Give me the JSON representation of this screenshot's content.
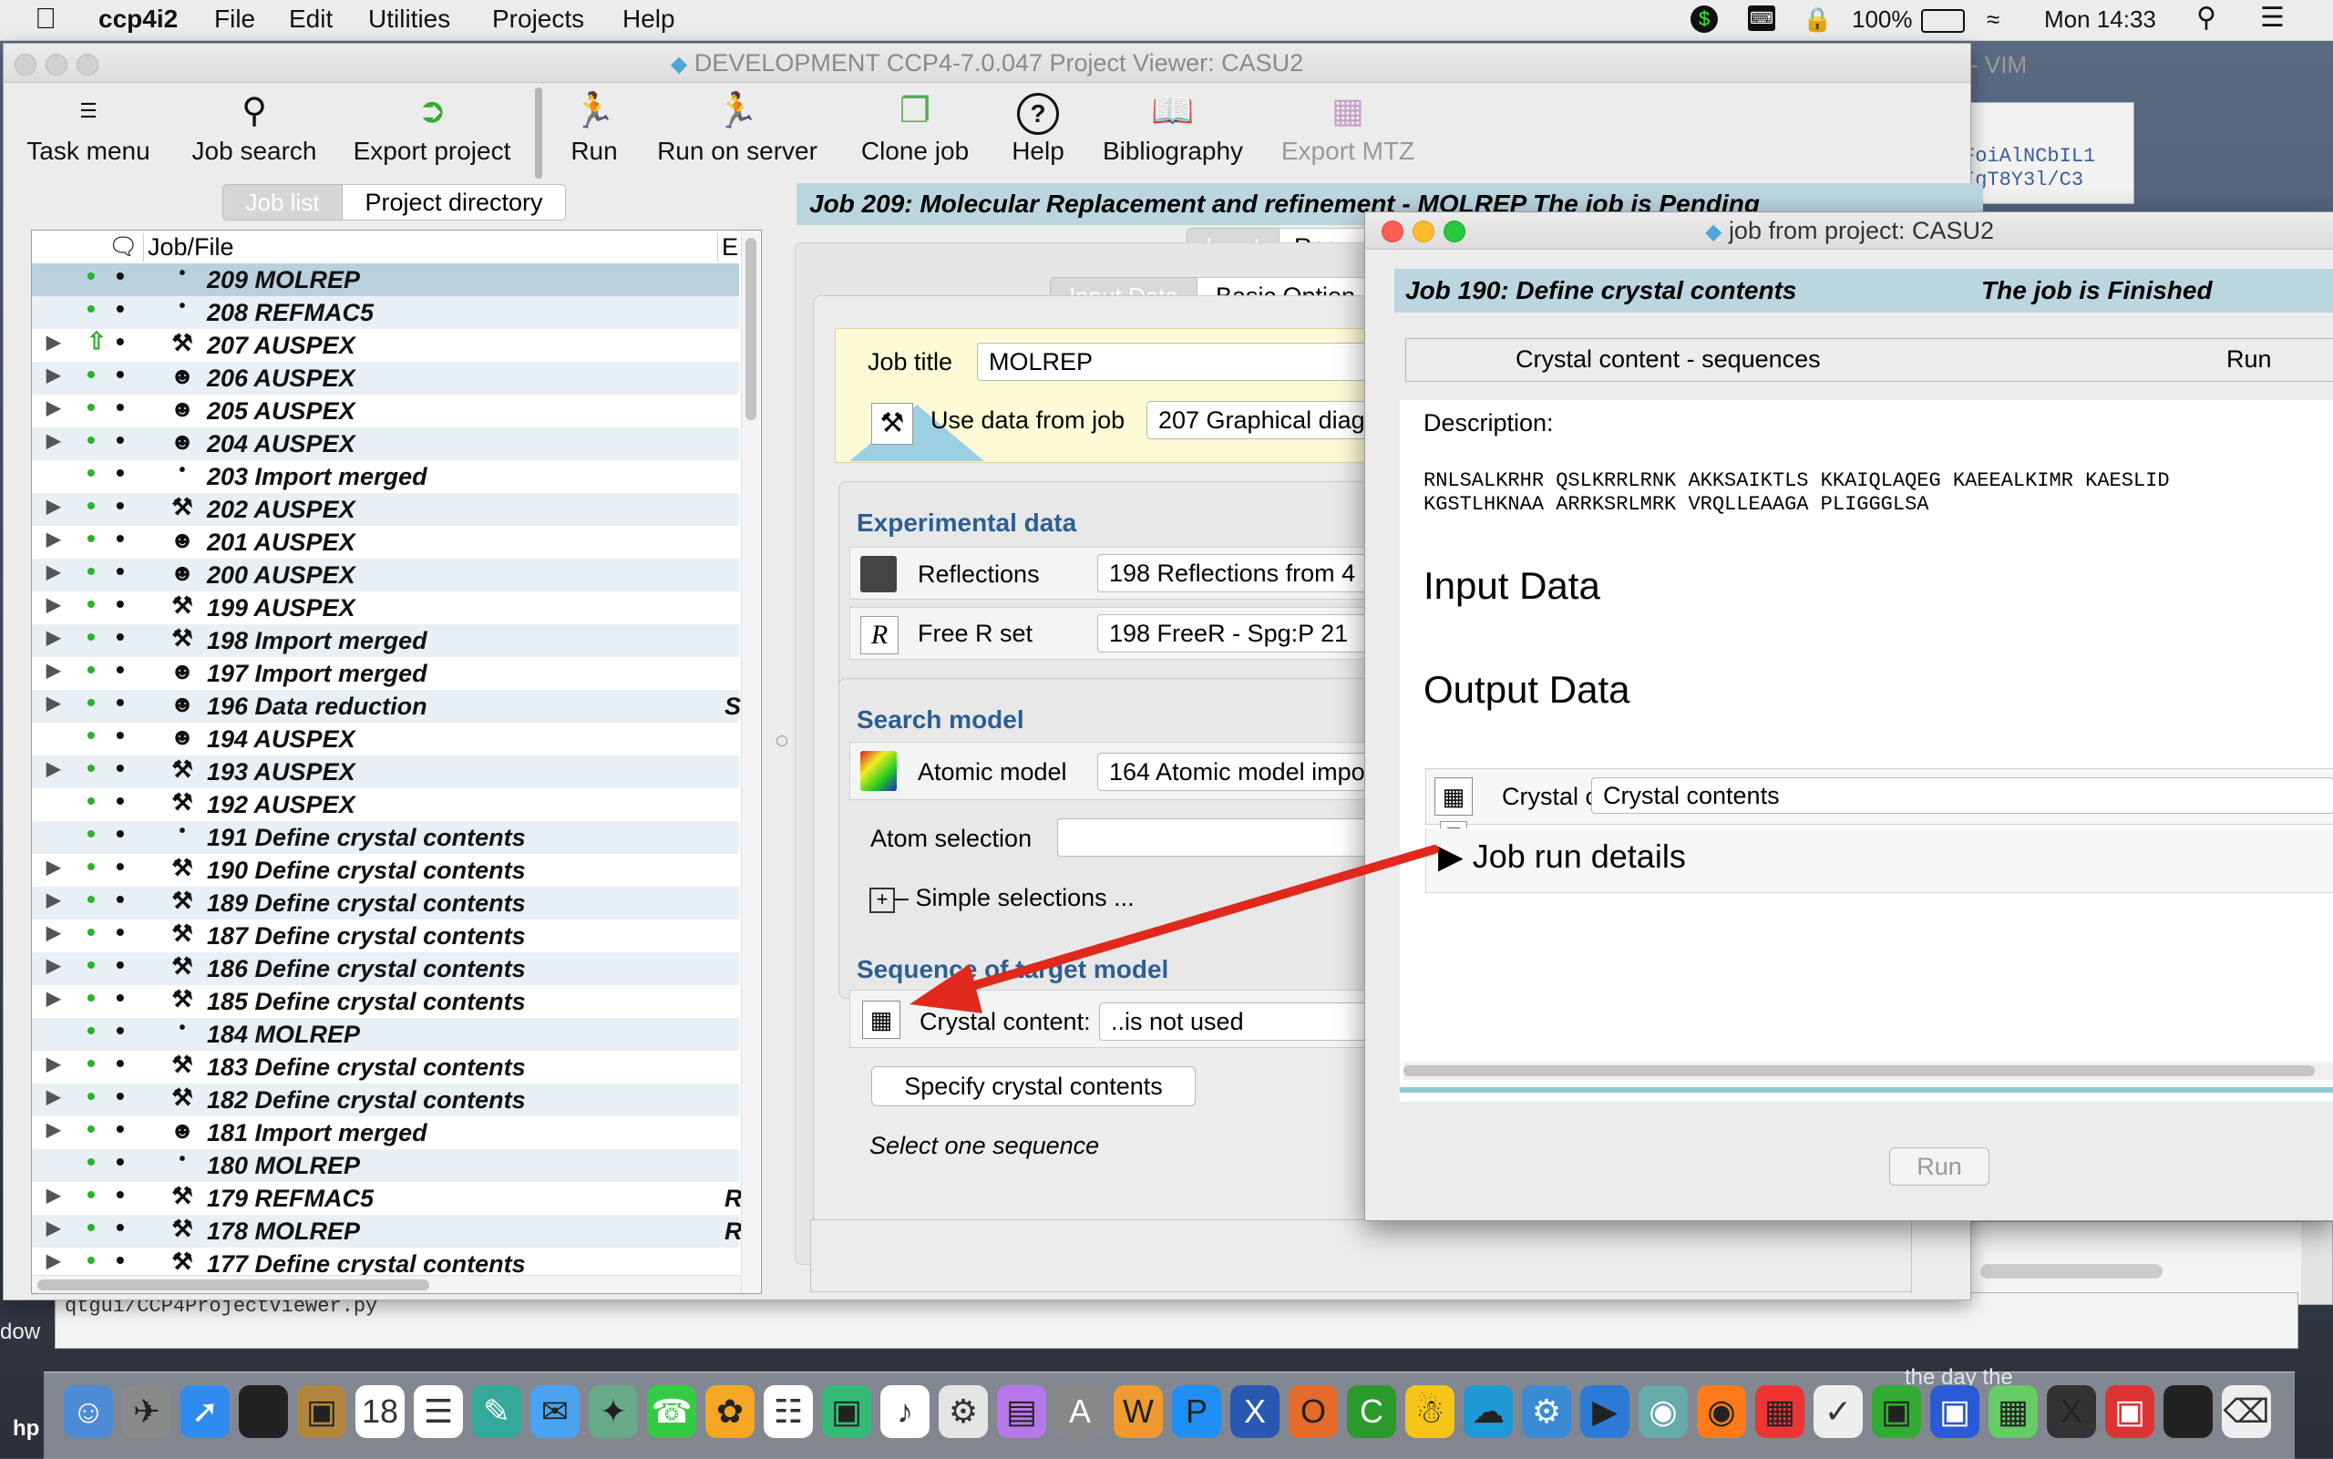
{
  "menubar": {
    "app_name": "ccp4i2",
    "items": [
      "File",
      "Edit",
      "Utilities",
      "Projects",
      "Help"
    ],
    "battery": "100%",
    "clock": "Mon 14:33"
  },
  "bg_window": {
    "title_fragment": "- VIM",
    "code_line1": "FoiAlNCbIL1",
    "code_line2": "IgT8Y3l/C3",
    "path": "qtgui/CCP4ProjectViewer.py",
    "desktop_text": "the day the",
    "desktop_left1": "dow",
    "desktop_left2": "hp"
  },
  "main_window": {
    "title": "DEVELOPMENT CCP4-7.0.047 Project Viewer: CASU2",
    "toolbar": [
      {
        "label": "Task menu",
        "icon": "task-menu-icon"
      },
      {
        "label": "Job search",
        "icon": "magnifier-icon"
      },
      {
        "label": "Export project",
        "icon": "export-icon"
      },
      {
        "label": "Run",
        "icon": "runner-icon"
      },
      {
        "label": "Run on server",
        "icon": "runner-server-icon"
      },
      {
        "label": "Clone job",
        "icon": "clone-icon"
      },
      {
        "label": "Help",
        "icon": "help-icon"
      },
      {
        "label": "Bibliography",
        "icon": "bibliography-icon"
      },
      {
        "label": "Export MTZ",
        "icon": "export-mtz-icon"
      }
    ],
    "tabs": {
      "job_list": "Job list",
      "project_directory": "Project directory"
    },
    "job_list_headers": {
      "file": "Job/File",
      "e": "E"
    },
    "jobs": [
      {
        "label": "209 MOLREP",
        "icon": "bullet",
        "tri": "",
        "e": ""
      },
      {
        "label": "208 REFMAC5",
        "icon": "bullet",
        "tri": "",
        "e": ""
      },
      {
        "label": "207 AUSPEX",
        "icon": "hammer",
        "tri": "▶",
        "e": ""
      },
      {
        "label": "206 AUSPEX",
        "icon": "face",
        "tri": "▶",
        "e": ""
      },
      {
        "label": "205 AUSPEX",
        "icon": "face",
        "tri": "▶",
        "e": ""
      },
      {
        "label": "204 AUSPEX",
        "icon": "face",
        "tri": "▶",
        "e": ""
      },
      {
        "label": "203 Import merged",
        "icon": "bullet",
        "tri": "",
        "e": ""
      },
      {
        "label": "202 AUSPEX",
        "icon": "hammer",
        "tri": "▶",
        "e": ""
      },
      {
        "label": "201 AUSPEX",
        "icon": "face",
        "tri": "▶",
        "e": ""
      },
      {
        "label": "200 AUSPEX",
        "icon": "face",
        "tri": "▶",
        "e": ""
      },
      {
        "label": "199 AUSPEX",
        "icon": "hammer",
        "tri": "▶",
        "e": ""
      },
      {
        "label": "198 Import merged",
        "icon": "hammer",
        "tri": "▶",
        "e": ""
      },
      {
        "label": "197 Import merged",
        "icon": "face",
        "tri": "▶",
        "e": ""
      },
      {
        "label": "196 Data reduction",
        "icon": "face",
        "tri": "▶",
        "e": "S"
      },
      {
        "label": "194 AUSPEX",
        "icon": "face",
        "tri": "",
        "e": ""
      },
      {
        "label": "193 AUSPEX",
        "icon": "hammer",
        "tri": "▶",
        "e": ""
      },
      {
        "label": "192 AUSPEX",
        "icon": "hammer",
        "tri": "",
        "e": ""
      },
      {
        "label": "191 Define crystal contents",
        "icon": "bullet",
        "tri": "",
        "e": ""
      },
      {
        "label": "190 Define crystal contents",
        "icon": "hammer",
        "tri": "▶",
        "e": ""
      },
      {
        "label": "189 Define crystal contents",
        "icon": "hammer",
        "tri": "▶",
        "e": ""
      },
      {
        "label": "187 Define crystal contents",
        "icon": "hammer",
        "tri": "▶",
        "e": ""
      },
      {
        "label": "186 Define crystal contents",
        "icon": "hammer",
        "tri": "▶",
        "e": ""
      },
      {
        "label": "185 Define crystal contents",
        "icon": "hammer",
        "tri": "▶",
        "e": ""
      },
      {
        "label": "184 MOLREP",
        "icon": "bullet",
        "tri": "",
        "e": ""
      },
      {
        "label": "183 Define crystal contents",
        "icon": "hammer",
        "tri": "▶",
        "e": ""
      },
      {
        "label": "182 Define crystal contents",
        "icon": "hammer",
        "tri": "▶",
        "e": ""
      },
      {
        "label": "181 Import merged",
        "icon": "face",
        "tri": "▶",
        "e": ""
      },
      {
        "label": "180 MOLREP",
        "icon": "bullet",
        "tri": "",
        "e": ""
      },
      {
        "label": "179 REFMAC5",
        "icon": "hammer",
        "tri": "▶",
        "e": "R"
      },
      {
        "label": "178 MOLREP",
        "icon": "hammer",
        "tri": "▶",
        "e": "R"
      },
      {
        "label": "177 Define crystal contents",
        "icon": "hammer",
        "tri": "▶",
        "e": ""
      }
    ],
    "job_header": "Job 209:  Molecular Replacement and refinement - MOLREP   The job is Pending",
    "mode_tabs": {
      "input": "Input",
      "results": "Resu"
    },
    "sub_tabs": {
      "input_data": "Input Data",
      "basic_options": "Basic Option"
    },
    "job_title_label": "Job title",
    "job_title_value": "MOLREP",
    "use_data_label": "Use data from job",
    "use_data_value": "207 Graphical diag",
    "experimental_heading": "Experimental data",
    "reflections_label": "Reflections",
    "reflections_value": "198 Reflections from 4",
    "freer_label": "Free R set",
    "freer_value": "198 FreeR - Spg:P 21",
    "search_heading": "Search model",
    "atomic_label": "Atomic model",
    "atomic_value": "164 Atomic model impo",
    "atom_selection_label": "Atom selection",
    "simple_selections": "Simple selections ...",
    "sequence_heading": "Sequence of target model",
    "crystal_label": "Crystal content:",
    "crystal_value": "..is not used",
    "specify_button": "Specify crystal contents",
    "select_hint": "Select one sequence"
  },
  "job_window": {
    "title": "job from project: CASU2",
    "header_left": "Job 190:  Define crystal contents",
    "header_right": "The job is Finished",
    "tab_left": "Crystal content - sequences",
    "tab_right": "Run",
    "description_label": "Description:",
    "sequence_line1": "RNLSALKRHR QSLKRRLRNK AKKSAIKTLS KKAIQLAQEG KAEEALKIMR KAESLID",
    "sequence_line2": "KGSTLHKNAA ARRKSRLMRK VRQLLEAAGA PLIGGGLSA",
    "input_data_heading": "Input Data",
    "output_data_heading": "Output Data",
    "crystal_label": "Crystal contents",
    "crystal_value": "Crystal contents",
    "run_details": "Job run details",
    "run_button": "Run"
  },
  "colors": {
    "header_bg": "#bcd6e0",
    "section_blue": "#2b5f93",
    "selected_row": "#b9d1dc",
    "arrow_red": "#e0281c"
  }
}
